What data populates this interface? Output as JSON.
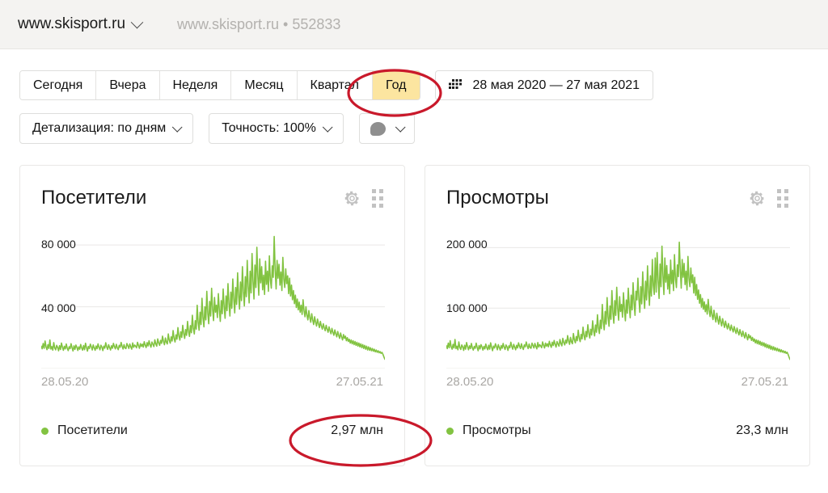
{
  "header": {
    "site_name": "www.skisport.ru",
    "site_picker_icon": "chevron-down-icon",
    "breadcrumb": "www.skisport.ru • 552833"
  },
  "controls": {
    "period_tabs": [
      {
        "label": "Сегодня",
        "active": false
      },
      {
        "label": "Вчера",
        "active": false
      },
      {
        "label": "Неделя",
        "active": false
      },
      {
        "label": "Месяц",
        "active": false
      },
      {
        "label": "Квартал",
        "active": false
      },
      {
        "label": "Год",
        "active": true
      }
    ],
    "date_range": {
      "icon": "calendar-grid-icon",
      "label": "28 мая 2020 — 27 мая 2021"
    },
    "detail_select": {
      "label": "Детализация: по дням",
      "icon": "chevron-down-icon"
    },
    "accuracy_select": {
      "label": "Точность: 100%",
      "icon": "chevron-down-icon"
    },
    "comments_button": {
      "icon": "speech-bubble-icon",
      "chevron": "chevron-down-icon"
    }
  },
  "cards": [
    {
      "title": "Посетители",
      "gear_icon": "gear-icon",
      "grid_icon": "grid-dots-icon",
      "legend_label": "Посетители",
      "total": "2,97 млн",
      "total_highlighted": true
    },
    {
      "title": "Просмотры",
      "gear_icon": "gear-icon",
      "grid_icon": "grid-dots-icon",
      "legend_label": "Просмотры",
      "total": "23,3 млн",
      "total_highlighted": false
    }
  ],
  "annotations": {
    "color": "#c9192b",
    "items": [
      {
        "name": "year-tab-circle",
        "target": "Год"
      },
      {
        "name": "visitors-total-circle",
        "target": "2,97 млн"
      }
    ]
  },
  "colors": {
    "line": "#82c341",
    "active_tab": "#fce5a0",
    "annotation_red": "#c9192b",
    "header_bg": "#f4f3f1"
  },
  "chart_data": [
    {
      "type": "line",
      "title": "Посетители",
      "xlabel": "",
      "ylabel": "",
      "x_tick_labels": [
        "28.05.20",
        "27.05.21"
      ],
      "y_tick_labels": [
        "80 000",
        "40 000"
      ],
      "ylim": [
        0,
        90000
      ],
      "y_gridlines": [
        0,
        40000,
        80000
      ],
      "grid": true,
      "legend": "bottom-left",
      "series_name": "Посетители",
      "series_color": "#82c341",
      "total_label": "2,97 млн",
      "values": [
        14500,
        12800,
        16200,
        13100,
        17800,
        14000,
        12200,
        15500,
        13000,
        18500,
        12600,
        14200,
        11900,
        16800,
        13400,
        12100,
        15000,
        13700,
        11500,
        14800,
        12300,
        16500,
        13900,
        11800,
        14400,
        12700,
        15900,
        13200,
        11600,
        14100,
        12900,
        16100,
        13500,
        11400,
        14700,
        12400,
        15200,
        13800,
        11700,
        14000,
        12500,
        15600,
        13300,
        11900,
        14900,
        12200,
        16400,
        13600,
        11300,
        14300,
        13000,
        15800,
        14100,
        12000,
        15300,
        13400,
        11800,
        14600,
        12800,
        16000,
        13700,
        12100,
        15100,
        13900,
        11600,
        14500,
        13200,
        16700,
        14000,
        12400,
        15400,
        13600,
        12000,
        14800,
        13100,
        16300,
        14200,
        12700,
        15700,
        13500,
        12200,
        15000,
        13800,
        16900,
        14400,
        12600,
        15500,
        13300,
        12900,
        16200,
        14700,
        13000,
        15900,
        14100,
        12500,
        16600,
        13700,
        15200,
        14500,
        13400,
        17000,
        14900,
        13100,
        16100,
        14300,
        15800,
        13900,
        17400,
        15100,
        13600,
        16800,
        14600,
        18000,
        15400,
        13800,
        17200,
        15700,
        14200,
        18600,
        16000,
        14500,
        19200,
        16600,
        15000,
        18200,
        16300,
        21000,
        17500,
        15400,
        19800,
        17000,
        15900,
        22400,
        18300,
        16400,
        20500,
        17800,
        24600,
        19500,
        17200,
        21800,
        19000,
        26500,
        21000,
        18400,
        23800,
        20200,
        28000,
        22600,
        19500,
        25200,
        21500,
        30500,
        24000,
        20800,
        27800,
        23200,
        34500,
        26000,
        22400,
        31000,
        25500,
        41000,
        30000,
        24800,
        36500,
        28500,
        45500,
        33000,
        27000,
        40000,
        31500,
        50000,
        36000,
        29000,
        43500,
        34000,
        52000,
        38500,
        31000,
        46000,
        36500,
        41000,
        33000,
        48500,
        38000,
        30500,
        44000,
        35500,
        51500,
        40000,
        32500,
        47000,
        37500,
        55000,
        42000,
        34000,
        49500,
        39000,
        58000,
        45000,
        36000,
        52500,
        41500,
        62000,
        47500,
        38500,
        56000,
        44000,
        66000,
        50000,
        40500,
        59500,
        46500,
        70000,
        53000,
        42500,
        63000,
        49000,
        74500,
        56500,
        45000,
        67000,
        52500,
        78500,
        60000,
        47500,
        71000,
        55500,
        66000,
        51000,
        60500,
        48000,
        69500,
        54500,
        63000,
        50000,
        73000,
        57500,
        52000,
        66500,
        59000,
        85500,
        64000,
        51500,
        70000,
        58500,
        67500,
        54000,
        62500,
        50500,
        72000,
        58000,
        52500,
        64500,
        55000,
        60000,
        48500,
        58500,
        47000,
        54000,
        44500,
        50500,
        42000,
        47500,
        39500,
        45000,
        38000,
        43000,
        36500,
        41000,
        35000,
        44500,
        37500,
        33500,
        40000,
        34500,
        31500,
        37500,
        33000,
        30000,
        35500,
        31500,
        28500,
        33500,
        30000,
        27500,
        32000,
        29000,
        26500,
        30500,
        27500,
        25500,
        29000,
        26500,
        24500,
        28000,
        25500,
        23500,
        27000,
        24500,
        22500,
        26000,
        23500,
        21500,
        25000,
        22500,
        20500,
        24000,
        21500,
        19500,
        23000,
        20500,
        18500,
        22000,
        19500,
        21000,
        18000,
        20000,
        17500,
        19000,
        16500,
        18500,
        16000,
        18000,
        15500,
        17500,
        15000,
        17000,
        14500,
        16500,
        14000,
        16000,
        13500,
        15500,
        13000,
        15000,
        12500,
        14500,
        12000,
        14000,
        11800,
        13500,
        11500,
        13000,
        11200,
        12500,
        10800,
        12000,
        10500,
        11500,
        10200,
        11000,
        9800,
        10500,
        9200,
        7500,
        6000
      ]
    },
    {
      "type": "line",
      "title": "Просмотры",
      "xlabel": "",
      "ylabel": "",
      "x_tick_labels": [
        "28.05.20",
        "27.05.21"
      ],
      "y_tick_labels": [
        "200 000",
        "100 000"
      ],
      "ylim": [
        0,
        230000
      ],
      "y_gridlines": [
        0,
        100000,
        200000
      ],
      "grid": true,
      "legend": "bottom-left",
      "series_name": "Просмотры",
      "series_color": "#82c341",
      "total_label": "23,3 млн",
      "values": [
        38000,
        33000,
        42000,
        34500,
        46000,
        36000,
        32000,
        40000,
        34000,
        48000,
        33000,
        37000,
        31000,
        44000,
        35000,
        31500,
        39000,
        36000,
        30000,
        38500,
        32000,
        43000,
        36500,
        31000,
        37500,
        33000,
        41500,
        34500,
        30500,
        36500,
        33500,
        42000,
        35000,
        29500,
        38000,
        32500,
        39500,
        36000,
        30500,
        36500,
        32500,
        40500,
        34500,
        31000,
        38500,
        32000,
        42500,
        35500,
        29500,
        37000,
        34000,
        41000,
        36500,
        31000,
        39500,
        35000,
        30500,
        38000,
        33500,
        41500,
        35500,
        31500,
        39000,
        36000,
        30000,
        37500,
        34500,
        43500,
        36500,
        32000,
        40000,
        35500,
        31000,
        38500,
        34000,
        42500,
        37000,
        33000,
        41000,
        35000,
        31500,
        39000,
        36000,
        44000,
        37500,
        33000,
        40500,
        34500,
        33500,
        42000,
        38000,
        34000,
        41500,
        36500,
        32500,
        43000,
        35500,
        39500,
        37500,
        34500,
        44000,
        38500,
        34000,
        42000,
        37000,
        41000,
        36000,
        45000,
        39000,
        35000,
        43500,
        38000,
        46500,
        40000,
        35500,
        44500,
        40500,
        37000,
        48000,
        41500,
        37500,
        50000,
        43000,
        39000,
        47000,
        42000,
        54500,
        45500,
        40000,
        51500,
        44000,
        41000,
        58000,
        47500,
        42500,
        53000,
        46000,
        63500,
        50500,
        44500,
        56500,
        49000,
        68500,
        54500,
        47500,
        61500,
        52500,
        72500,
        58500,
        50500,
        65000,
        55500,
        79000,
        62000,
        54000,
        72000,
        60000,
        89000,
        67000,
        58000,
        80000,
        66000,
        106000,
        77500,
        64000,
        94500,
        73500,
        117500,
        85000,
        70000,
        103500,
        81500,
        129000,
        93000,
        75000,
        112500,
        88000,
        134500,
        99500,
        80000,
        119000,
        94500,
        106000,
        85000,
        125500,
        98000,
        79000,
        113500,
        91500,
        133000,
        103500,
        84000,
        121500,
        97000,
        142000,
        108500,
        88000,
        128000,
        113500,
        149500,
        116000,
        93000,
        135500,
        107000,
        160000,
        122500,
        99500,
        144500,
        113500,
        170000,
        129000,
        104500,
        153500,
        120000,
        180500,
        137000,
        122500,
        183000,
        126500,
        192000,
        146000,
        116000,
        173000,
        135500,
        202500,
        155000,
        122500,
        183000,
        143000,
        170500,
        131500,
        156000,
        124000,
        179500,
        140500,
        162500,
        129000,
        188500,
        148500,
        134000,
        171500,
        152000,
        209000,
        165000,
        133000,
        180500,
        151000,
        174000,
        139000,
        161000,
        130000,
        185500,
        149500,
        135500,
        166500,
        142000,
        155000,
        125000,
        151000,
        121000,
        139000,
        114500,
        130000,
        108000,
        122500,
        101500,
        116000,
        98000,
        110500,
        94000,
        105500,
        90000,
        114500,
        96500,
        86000,
        103000,
        88500,
        81000,
        96500,
        85000,
        77000,
        91500,
        81000,
        73500,
        86500,
        77500,
        70500,
        82500,
        74500,
        68000,
        78500,
        71000,
        65500,
        74500,
        68000,
        63000,
        72000,
        65500,
        60500,
        69500,
        63000,
        58000,
        67000,
        60500,
        55500,
        64500,
        58000,
        53000,
        62000,
        55500,
        50500,
        59500,
        53000,
        47500,
        56500,
        50500,
        54000,
        46500,
        51500,
        45000,
        49000,
        42500,
        47500,
        41000,
        46500,
        40000,
        45000,
        38500,
        43500,
        37500,
        42500,
        36000,
        41000,
        34500,
        39500,
        33500,
        38500,
        32000,
        37000,
        31000,
        36000,
        30500,
        34500,
        29500,
        33500,
        28500,
        32000,
        27500,
        31000,
        27000,
        29500,
        26000,
        28500,
        25000,
        27000,
        23500,
        19000,
        15000
      ]
    }
  ]
}
